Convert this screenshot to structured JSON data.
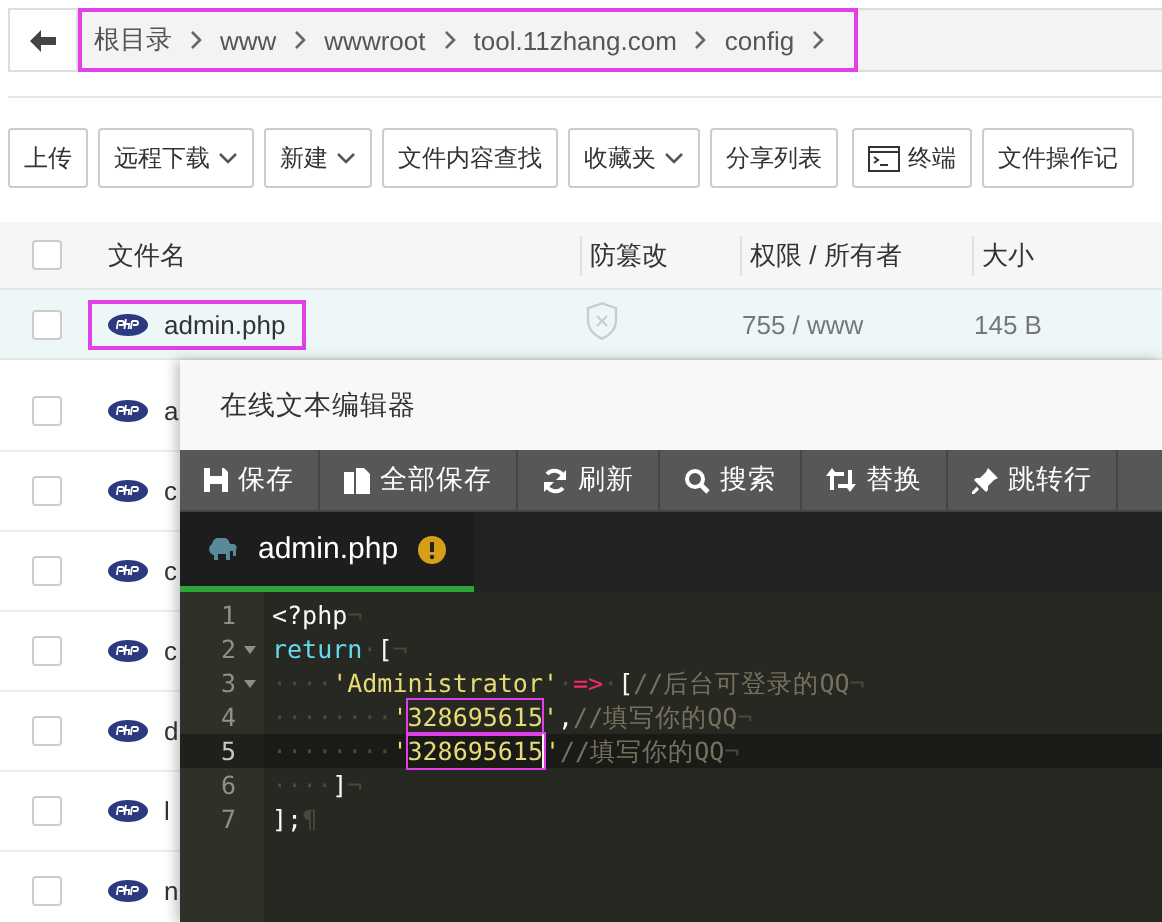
{
  "breadcrumb": {
    "highlighted": true,
    "segments": [
      "根目录",
      "www",
      "wwwroot",
      "tool.11zhang.com",
      "config"
    ]
  },
  "toolbar": [
    {
      "label": "上传",
      "kind": "plain"
    },
    {
      "label": "远程下载",
      "kind": "dropdown"
    },
    {
      "label": "新建",
      "kind": "dropdown"
    },
    {
      "label": "文件内容查找",
      "kind": "plain"
    },
    {
      "label": "收藏夹",
      "kind": "dropdown"
    },
    {
      "label": "分享列表",
      "kind": "plain"
    },
    {
      "label": "终端",
      "kind": "terminal"
    },
    {
      "label": "文件操作记",
      "kind": "plain"
    }
  ],
  "table": {
    "all_checked": false,
    "columns": [
      "文件名",
      "防篡改",
      "权限 / 所有者",
      "大小"
    ],
    "rows": [
      {
        "name": "admin.php",
        "selected": true,
        "highlighted": true,
        "checked": false,
        "protected": false,
        "permission": "755 / www",
        "size": "145 B"
      },
      {
        "name": "a",
        "selected": false,
        "highlighted": false,
        "checked": false
      },
      {
        "name": "c",
        "selected": false,
        "highlighted": false,
        "checked": false
      },
      {
        "name": "c",
        "selected": false,
        "highlighted": false,
        "checked": false
      },
      {
        "name": "c",
        "selected": false,
        "highlighted": false,
        "checked": false
      },
      {
        "name": "d",
        "selected": false,
        "highlighted": false,
        "checked": false
      },
      {
        "name": "l",
        "selected": false,
        "highlighted": false,
        "checked": false
      },
      {
        "name": "n",
        "selected": false,
        "highlighted": false,
        "checked": false
      }
    ]
  },
  "editor": {
    "title": "在线文本编辑器",
    "toolbar": [
      {
        "label": "保存",
        "kind": "save"
      },
      {
        "label": "全部保存",
        "kind": "save-all"
      },
      {
        "label": "刷新",
        "kind": "refresh"
      },
      {
        "label": "搜索",
        "kind": "search"
      },
      {
        "label": "替换",
        "kind": "replace"
      },
      {
        "label": "跳转行",
        "kind": "goto"
      }
    ],
    "tabs": [
      {
        "label": "admin.php",
        "selected": true,
        "modified": true
      }
    ],
    "lines": [
      {
        "number": "1",
        "foldable": false,
        "active": false,
        "tokens": [
          {
            "kind": "plain",
            "text": "<?php"
          },
          {
            "kind": "eol",
            "text": "¬"
          }
        ]
      },
      {
        "number": "2",
        "foldable": true,
        "active": false,
        "tokens": [
          {
            "kind": "keyword",
            "text": "return"
          },
          {
            "kind": "ws",
            "text": "·"
          },
          {
            "kind": "plain",
            "text": "["
          },
          {
            "kind": "eol",
            "text": "¬"
          }
        ]
      },
      {
        "number": "3",
        "foldable": true,
        "active": false,
        "tokens": [
          {
            "kind": "ws",
            "text": "····"
          },
          {
            "kind": "string",
            "text": "'Administrator'"
          },
          {
            "kind": "ws",
            "text": "·"
          },
          {
            "kind": "operator",
            "text": "=>"
          },
          {
            "kind": "ws",
            "text": "·"
          },
          {
            "kind": "plain",
            "text": "["
          },
          {
            "kind": "comment",
            "text": "//后台可登录的QQ"
          },
          {
            "kind": "eol",
            "text": "¬"
          }
        ]
      },
      {
        "number": "4",
        "foldable": false,
        "active": false,
        "tokens": [
          {
            "kind": "ws",
            "text": "········"
          },
          {
            "kind": "string",
            "text": "'"
          },
          {
            "kind": "string",
            "text": "328695615",
            "highlighted": true
          },
          {
            "kind": "string",
            "text": "'"
          },
          {
            "kind": "plain",
            "text": ","
          },
          {
            "kind": "comment",
            "text": "//填写你的QQ"
          },
          {
            "kind": "eol",
            "text": "¬"
          }
        ]
      },
      {
        "number": "5",
        "foldable": false,
        "active": true,
        "tokens": [
          {
            "kind": "ws",
            "text": "········"
          },
          {
            "kind": "string",
            "text": "'"
          },
          {
            "kind": "string",
            "text": "328695615",
            "highlighted": true,
            "cursor": true
          },
          {
            "kind": "string",
            "text": "'"
          },
          {
            "kind": "comment",
            "text": "//填写你的QQ"
          },
          {
            "kind": "eol",
            "text": "¬"
          }
        ]
      },
      {
        "number": "6",
        "foldable": false,
        "active": false,
        "tokens": [
          {
            "kind": "ws",
            "text": "····"
          },
          {
            "kind": "plain",
            "text": "]"
          },
          {
            "kind": "eol",
            "text": "¬"
          }
        ]
      },
      {
        "number": "7",
        "foldable": false,
        "active": false,
        "tokens": [
          {
            "kind": "plain",
            "text": "];"
          },
          {
            "kind": "eol",
            "text": "¶"
          }
        ]
      }
    ]
  }
}
